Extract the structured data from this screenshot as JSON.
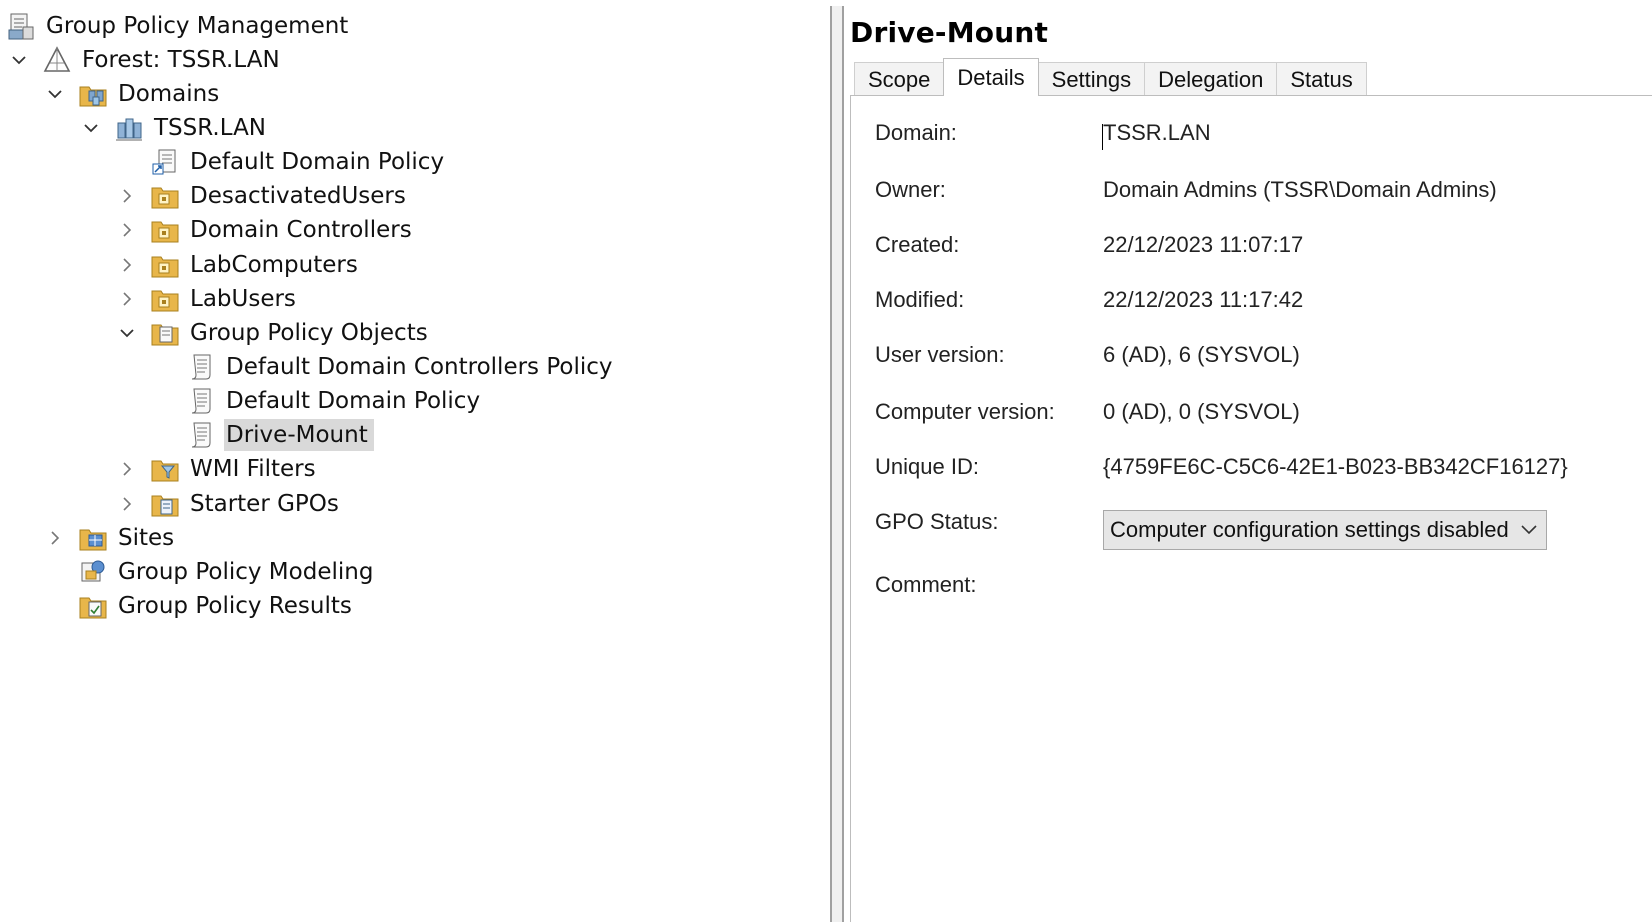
{
  "tree": {
    "nodes": [
      {
        "label": "Group Policy Management",
        "icon": "gpmc-icon",
        "expander": "none"
      },
      {
        "label": "Forest: TSSR.LAN",
        "icon": "forest-icon",
        "expander": "expanded"
      },
      {
        "label": "Domains",
        "icon": "domains-folder-icon",
        "expander": "expanded"
      },
      {
        "label": "TSSR.LAN",
        "icon": "domain-icon",
        "expander": "expanded"
      },
      {
        "label": "Default Domain Policy",
        "icon": "gpo-link-icon",
        "expander": "none"
      },
      {
        "label": "DesactivatedUsers",
        "icon": "ou-folder-icon",
        "expander": "collapsed"
      },
      {
        "label": "Domain Controllers",
        "icon": "ou-folder-icon",
        "expander": "collapsed"
      },
      {
        "label": "LabComputers",
        "icon": "ou-folder-icon",
        "expander": "collapsed"
      },
      {
        "label": "LabUsers",
        "icon": "ou-folder-icon",
        "expander": "collapsed"
      },
      {
        "label": "Group Policy Objects",
        "icon": "gpo-container-icon",
        "expander": "expanded"
      },
      {
        "label": "Default Domain Controllers Policy",
        "icon": "gpo-scroll-icon",
        "expander": "none"
      },
      {
        "label": "Default Domain Policy",
        "icon": "gpo-scroll-icon",
        "expander": "none"
      },
      {
        "label": "Drive-Mount",
        "icon": "gpo-scroll-icon",
        "expander": "none",
        "selected": true
      },
      {
        "label": "WMI Filters",
        "icon": "wmi-filter-folder-icon",
        "expander": "collapsed"
      },
      {
        "label": "Starter GPOs",
        "icon": "starter-gpo-folder-icon",
        "expander": "collapsed"
      },
      {
        "label": "Sites",
        "icon": "sites-icon",
        "expander": "collapsed"
      },
      {
        "label": "Group Policy Modeling",
        "icon": "modeling-icon",
        "expander": "none"
      },
      {
        "label": "Group Policy Results",
        "icon": "results-icon",
        "expander": "none"
      }
    ]
  },
  "detail": {
    "title": "Drive-Mount",
    "tabs": [
      {
        "label": "Scope",
        "active": false
      },
      {
        "label": "Details",
        "active": true
      },
      {
        "label": "Settings",
        "active": false
      },
      {
        "label": "Delegation",
        "active": false
      },
      {
        "label": "Status",
        "active": false
      }
    ],
    "properties": {
      "domain": {
        "label": "Domain:",
        "value": "TSSR.LAN"
      },
      "owner": {
        "label": "Owner:",
        "value": "Domain Admins (TSSR\\Domain Admins)"
      },
      "created": {
        "label": "Created:",
        "value": "22/12/2023 11:07:17"
      },
      "modified": {
        "label": "Modified:",
        "value": "22/12/2023 11:17:42"
      },
      "user_version": {
        "label": "User version:",
        "value": "6 (AD), 6 (SYSVOL)"
      },
      "computer_version": {
        "label": "Computer version:",
        "value": "0 (AD), 0 (SYSVOL)"
      },
      "unique_id": {
        "label": "Unique ID:",
        "value": "{4759FE6C-C5C6-42E1-B023-BB342CF16127}"
      },
      "gpo_status": {
        "label": "GPO Status:",
        "value": "Computer configuration settings disabled"
      },
      "comment": {
        "label": "Comment:",
        "value": ""
      }
    }
  },
  "colors": {
    "selection": "#d9d9d9",
    "folder": "#e8b64a",
    "pane_border": "#a0a0a0"
  }
}
